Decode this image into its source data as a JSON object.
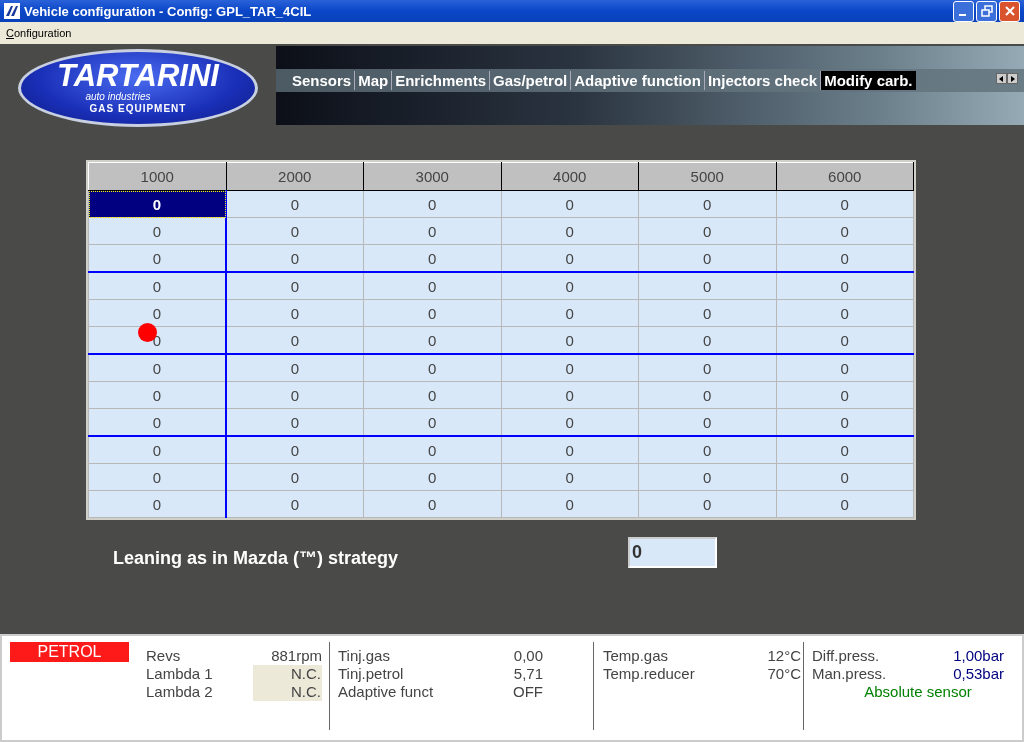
{
  "window": {
    "title": "Vehicle configuration - Config: GPL_TAR_4CIL"
  },
  "menu": [
    {
      "label": "Configuration",
      "accelerator_underlined": true
    }
  ],
  "logo": {
    "name": "TARTARINI",
    "tagline": "auto industries",
    "subtitle": "GAS EQUIPMENT"
  },
  "tabs": [
    {
      "label": "Sensors",
      "selected": false
    },
    {
      "label": "Map",
      "selected": false
    },
    {
      "label": "Enrichments",
      "selected": false
    },
    {
      "label": "Gas/petrol",
      "selected": false
    },
    {
      "label": "Adaptive function",
      "selected": false
    },
    {
      "label": "Injectors check",
      "selected": false
    },
    {
      "label": "Modify carb.",
      "selected": true
    }
  ],
  "table": {
    "columns": [
      "1000",
      "2000",
      "3000",
      "4000",
      "5000",
      "6000"
    ],
    "rows": [
      [
        {
          "value": "0",
          "selected": true
        },
        {
          "value": "0",
          "selected": false
        },
        {
          "value": "0",
          "selected": false
        },
        {
          "value": "0",
          "selected": false
        },
        {
          "value": "0",
          "selected": false
        },
        {
          "value": "0",
          "selected": false
        }
      ],
      [
        {
          "value": "0",
          "selected": false
        },
        {
          "value": "0",
          "selected": false
        },
        {
          "value": "0",
          "selected": false
        },
        {
          "value": "0",
          "selected": false
        },
        {
          "value": "0",
          "selected": false
        },
        {
          "value": "0",
          "selected": false
        }
      ],
      [
        {
          "value": "0",
          "selected": false
        },
        {
          "value": "0",
          "selected": false
        },
        {
          "value": "0",
          "selected": false
        },
        {
          "value": "0",
          "selected": false
        },
        {
          "value": "0",
          "selected": false
        },
        {
          "value": "0",
          "selected": false
        }
      ],
      [
        {
          "value": "0",
          "selected": false
        },
        {
          "value": "0",
          "selected": false
        },
        {
          "value": "0",
          "selected": false
        },
        {
          "value": "0",
          "selected": false
        },
        {
          "value": "0",
          "selected": false
        },
        {
          "value": "0",
          "selected": false
        }
      ],
      [
        {
          "value": "0",
          "selected": false
        },
        {
          "value": "0",
          "selected": false
        },
        {
          "value": "0",
          "selected": false
        },
        {
          "value": "0",
          "selected": false
        },
        {
          "value": "0",
          "selected": false
        },
        {
          "value": "0",
          "selected": false
        }
      ],
      [
        {
          "value": "0",
          "selected": false
        },
        {
          "value": "0",
          "selected": false
        },
        {
          "value": "0",
          "selected": false
        },
        {
          "value": "0",
          "selected": false
        },
        {
          "value": "0",
          "selected": false
        },
        {
          "value": "0",
          "selected": false
        }
      ],
      [
        {
          "value": "0",
          "selected": false
        },
        {
          "value": "0",
          "selected": false
        },
        {
          "value": "0",
          "selected": false
        },
        {
          "value": "0",
          "selected": false
        },
        {
          "value": "0",
          "selected": false
        },
        {
          "value": "0",
          "selected": false
        }
      ],
      [
        {
          "value": "0",
          "selected": false
        },
        {
          "value": "0",
          "selected": false
        },
        {
          "value": "0",
          "selected": false
        },
        {
          "value": "0",
          "selected": false
        },
        {
          "value": "0",
          "selected": false
        },
        {
          "value": "0",
          "selected": false
        }
      ],
      [
        {
          "value": "0",
          "selected": false
        },
        {
          "value": "0",
          "selected": false
        },
        {
          "value": "0",
          "selected": false
        },
        {
          "value": "0",
          "selected": false
        },
        {
          "value": "0",
          "selected": false
        },
        {
          "value": "0",
          "selected": false
        }
      ],
      [
        {
          "value": "0",
          "selected": false
        },
        {
          "value": "0",
          "selected": false
        },
        {
          "value": "0",
          "selected": false
        },
        {
          "value": "0",
          "selected": false
        },
        {
          "value": "0",
          "selected": false
        },
        {
          "value": "0",
          "selected": false
        }
      ],
      [
        {
          "value": "0",
          "selected": false
        },
        {
          "value": "0",
          "selected": false
        },
        {
          "value": "0",
          "selected": false
        },
        {
          "value": "0",
          "selected": false
        },
        {
          "value": "0",
          "selected": false
        },
        {
          "value": "0",
          "selected": false
        }
      ],
      [
        {
          "value": "0",
          "selected": false
        },
        {
          "value": "0",
          "selected": false
        },
        {
          "value": "0",
          "selected": false
        },
        {
          "value": "0",
          "selected": false
        },
        {
          "value": "0",
          "selected": false
        },
        {
          "value": "0",
          "selected": false
        }
      ]
    ]
  },
  "leaning": {
    "label": "Leaning as in Mazda (™) strategy",
    "value": "0"
  },
  "status_bar": {
    "fuel_mode": {
      "label": "PETROL",
      "color": "#ff1a1a"
    },
    "groups": [
      {
        "items": [
          {
            "label": "Revs",
            "value": "881rpm",
            "kind": "plain"
          },
          {
            "label": "Lambda 1",
            "value": "N.C.",
            "kind": "shaded"
          },
          {
            "label": "Lambda 2",
            "value": "N.C.",
            "kind": "shaded"
          }
        ]
      },
      {
        "items": [
          {
            "label": "Tinj.gas",
            "value": "0,00",
            "kind": "plain"
          },
          {
            "label": "Tinj.petrol",
            "value": "5,71",
            "kind": "plain"
          },
          {
            "label": "Adaptive funct",
            "value": "OFF",
            "kind": "plain"
          }
        ]
      },
      {
        "items": [
          {
            "label": "Temp.gas",
            "value": "12°C",
            "kind": "plain"
          },
          {
            "label": "Temp.reducer",
            "value": "70°C",
            "kind": "plain"
          }
        ]
      },
      {
        "items": [
          {
            "label": "Diff.press.",
            "value": "1,00bar",
            "kind": "accent"
          },
          {
            "label": "Man.press.",
            "value": "0,53bar",
            "kind": "accent"
          }
        ],
        "note": "Absolute sensor"
      }
    ]
  }
}
